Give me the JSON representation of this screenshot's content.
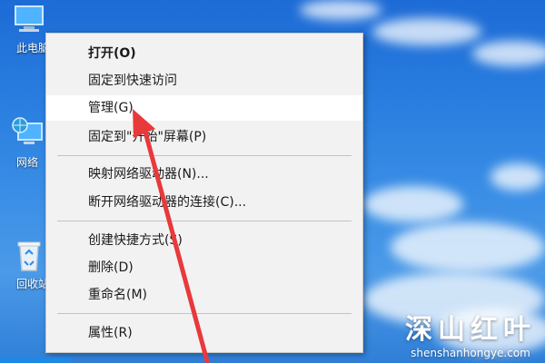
{
  "desktop": {
    "icons": [
      {
        "label": "此电脑",
        "icon": "this-pc-icon"
      },
      {
        "label": "网络",
        "icon": "network-icon"
      },
      {
        "label": "回收站",
        "icon": "recycle-bin-icon"
      }
    ]
  },
  "context_menu": {
    "items": [
      {
        "label": "打开(O)"
      },
      {
        "label": "固定到快速访问"
      },
      {
        "label": "管理(G)"
      },
      {
        "label": "固定到\"开始\"屏幕(P)"
      },
      {
        "label": "映射网络驱动器(N)..."
      },
      {
        "label": "断开网络驱动器的连接(C)..."
      },
      {
        "label": "创建快捷方式(S)"
      },
      {
        "label": "删除(D)"
      },
      {
        "label": "重命名(M)"
      },
      {
        "label": "属性(R)"
      }
    ]
  },
  "watermark": {
    "title": "深山红叶",
    "url": "shenshanhongye.com"
  },
  "colors": {
    "menu_bg": "#f2f2f2",
    "hover_bg": "#ffffff",
    "arrow": "#e8393b",
    "desktop_sky": "#2a7fe0"
  }
}
